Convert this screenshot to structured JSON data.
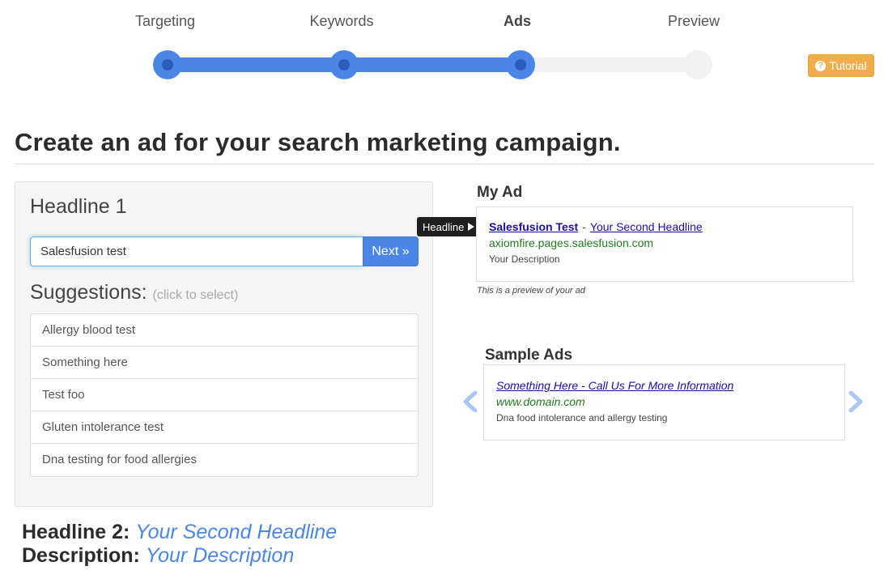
{
  "stepper": {
    "steps": [
      {
        "label": "Targeting",
        "state": "done"
      },
      {
        "label": "Keywords",
        "state": "done"
      },
      {
        "label": "Ads",
        "state": "current"
      },
      {
        "label": "Preview",
        "state": "todo"
      }
    ],
    "progress_fraction": 0.667
  },
  "tutorial": {
    "label": "Tutorial",
    "icon": "question-circle-icon"
  },
  "page": {
    "title": "Create an ad for your search marketing campaign."
  },
  "headline1": {
    "label": "Headline 1",
    "value": "Salesfusion test",
    "next_label": "Next »"
  },
  "suggestions": {
    "title": "Suggestions:",
    "hint": "(click to select)",
    "items": [
      "Allergy blood test",
      "Something here",
      "Test foo",
      "Gluten intolerance test",
      "Dna testing for food allergies"
    ]
  },
  "summary": {
    "headline2_label": "Headline 2:",
    "headline2_value": "Your Second Headline",
    "description_label": "Description:",
    "description_value": "Your Description"
  },
  "my_ad": {
    "heading": "My Ad",
    "tooltip": "Headline",
    "headline1": "Salesfusion Test",
    "separator": "-",
    "headline2": "Your Second Headline",
    "url": "axiomfire.pages.salesfusion.com",
    "description": "Your Description",
    "note": "This is a preview of your ad"
  },
  "sample_ads": {
    "heading": "Sample Ads",
    "headline": "Something Here - Call Us For More Information",
    "url": "www.domain.com",
    "description": "Dna food intolerance and allergy testing"
  },
  "colors": {
    "accent": "#4a86e8",
    "tutorial": "#f0ad4e",
    "ad_link": "#1a0dab",
    "ad_url": "#1f7a1f"
  }
}
